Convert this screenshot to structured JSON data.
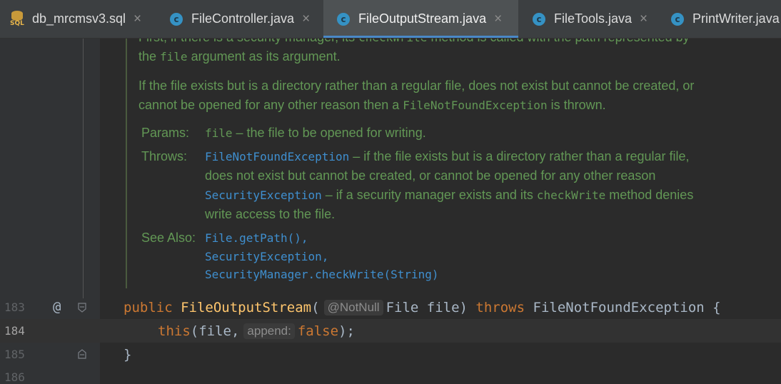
{
  "tabs": [
    {
      "label": "db_mrcmsv3.sql",
      "icon": "sql-file-icon",
      "active": false
    },
    {
      "label": "FileController.java",
      "icon": "java-class-icon",
      "active": false
    },
    {
      "label": "FileOutputStream.java",
      "icon": "java-class-icon",
      "active": true
    },
    {
      "label": "FileTools.java",
      "icon": "java-class-icon",
      "active": false
    },
    {
      "label": "PrintWriter.java",
      "icon": "java-class-icon",
      "active": false
    }
  ],
  "tab_close_glyph": "×",
  "icon_letter": "c",
  "sql_icon_label": "SQL",
  "doc": {
    "line0_a": "First, if there is a security manager, its ",
    "line0_code": "checkWrite",
    "line0_b": " method is called with the path represented by",
    "line1_a": "the ",
    "line1_code": "file",
    "line1_b": " argument as its argument.",
    "line2": "If the file exists but is a directory rather than a regular file, does not exist but cannot be created, or",
    "line3_a": "cannot be opened for any other reason then a ",
    "line3_code": "FileNotFoundException",
    "line3_b": " is thrown.",
    "params_label": "Params:",
    "params_code": "file",
    "params_text": " – the file to be opened for writing.",
    "throws_label": "Throws:",
    "throws1_link": "FileNotFoundException",
    "throws1_text": " – if the file exists but is a directory rather than a regular file,",
    "throws1_cont": "does not exist but cannot be created, or cannot be opened for any other reason",
    "throws2_link": "SecurityException",
    "throws2_text_a": " – if a security manager exists and its ",
    "throws2_code": "checkWrite",
    "throws2_text_b": " method denies",
    "throws2_cont": "write access to the file.",
    "see_label": "See Also:",
    "see1": "File.getPath(),",
    "see2": "SecurityException,",
    "see3": "SecurityManager.checkWrite(String)"
  },
  "line_numbers": {
    "l183": "183",
    "l184": "184",
    "l185": "185",
    "l186": "186"
  },
  "gutter_at": "@",
  "code": {
    "l183_kw": "public",
    "l183_fn": "FileOutputStream",
    "l183_paren": "(",
    "l183_hint": "@NotNull",
    "l183_param": "File file)",
    "l183_throws": "throws",
    "l183_rest": "FileNotFoundException {",
    "l184_this": "this",
    "l184_args": "(file,",
    "l184_hint": "append:",
    "l184_false": "false",
    "l184_end": ");",
    "l185": "}"
  },
  "colors": {
    "background": "#2b2b2b",
    "doc_text": "#629755",
    "keyword": "#cc7832",
    "method": "#ffc66d",
    "link": "#3f8fcf",
    "tab_underline": "#4a88c7"
  }
}
